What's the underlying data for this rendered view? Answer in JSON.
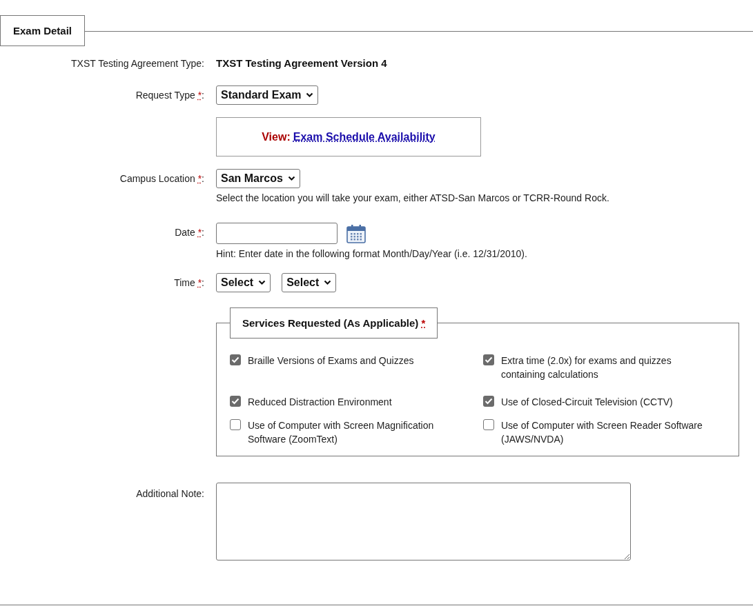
{
  "section": {
    "title": "Exam Detail"
  },
  "fields": [
    {
      "kind": "text",
      "label": "TXST Testing Agreement Type:",
      "value": "TXST Testing Agreement Version 4"
    },
    {
      "kind": "select",
      "label": "Request Type",
      "required_mark": "*",
      "label_end": ":",
      "selects": [
        "Standard Exam"
      ],
      "link_box": {
        "prefix": "View:",
        "link": "Exam Schedule Availability"
      }
    },
    {
      "kind": "select",
      "label": "Campus Location",
      "required_mark": "*",
      "label_end": ":",
      "selects": [
        "San Marcos"
      ],
      "hint": "Select the location you will take your exam, either ATSD-San Marcos or TCRR-Round Rock."
    },
    {
      "kind": "date",
      "label": "Date",
      "required_mark": "*",
      "label_end": ":",
      "hint": "Hint: Enter date in the following format Month/Day/Year (i.e. 12/31/2010)."
    },
    {
      "kind": "select",
      "label": "Time",
      "required_mark": "*",
      "label_end": ":",
      "selects": [
        "Select",
        "Select"
      ]
    }
  ],
  "services": {
    "title": "Services Requested (As Applicable)",
    "required_mark": "*",
    "items": [
      {
        "label": "Braille Versions of Exams and Quizzes",
        "checked": true
      },
      {
        "label": "Extra time (2.0x) for exams and quizzes containing calculations",
        "checked": true
      },
      {
        "label": "Reduced Distraction Environment",
        "checked": true
      },
      {
        "label": "Use of Closed-Circuit Television (CCTV)",
        "checked": true
      },
      {
        "label": "Use of Computer with Screen Magnification Software (ZoomText)",
        "checked": false
      },
      {
        "label": "Use of Computer with Screen Reader Software (JAWS/NVDA)",
        "checked": false
      }
    ]
  },
  "note": {
    "label": "Additional Note:"
  }
}
